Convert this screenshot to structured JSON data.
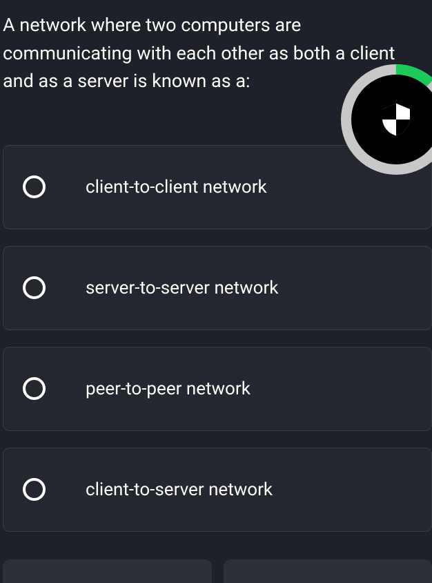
{
  "question": {
    "text": "A network where two computers are communicating with each other as both a client and as a server is known as a:"
  },
  "options": [
    {
      "label": "client-to-client network"
    },
    {
      "label": "server-to-server network"
    },
    {
      "label": "peer-to-peer network"
    },
    {
      "label": "client-to-server network"
    }
  ],
  "progress": {
    "percent": 12
  }
}
